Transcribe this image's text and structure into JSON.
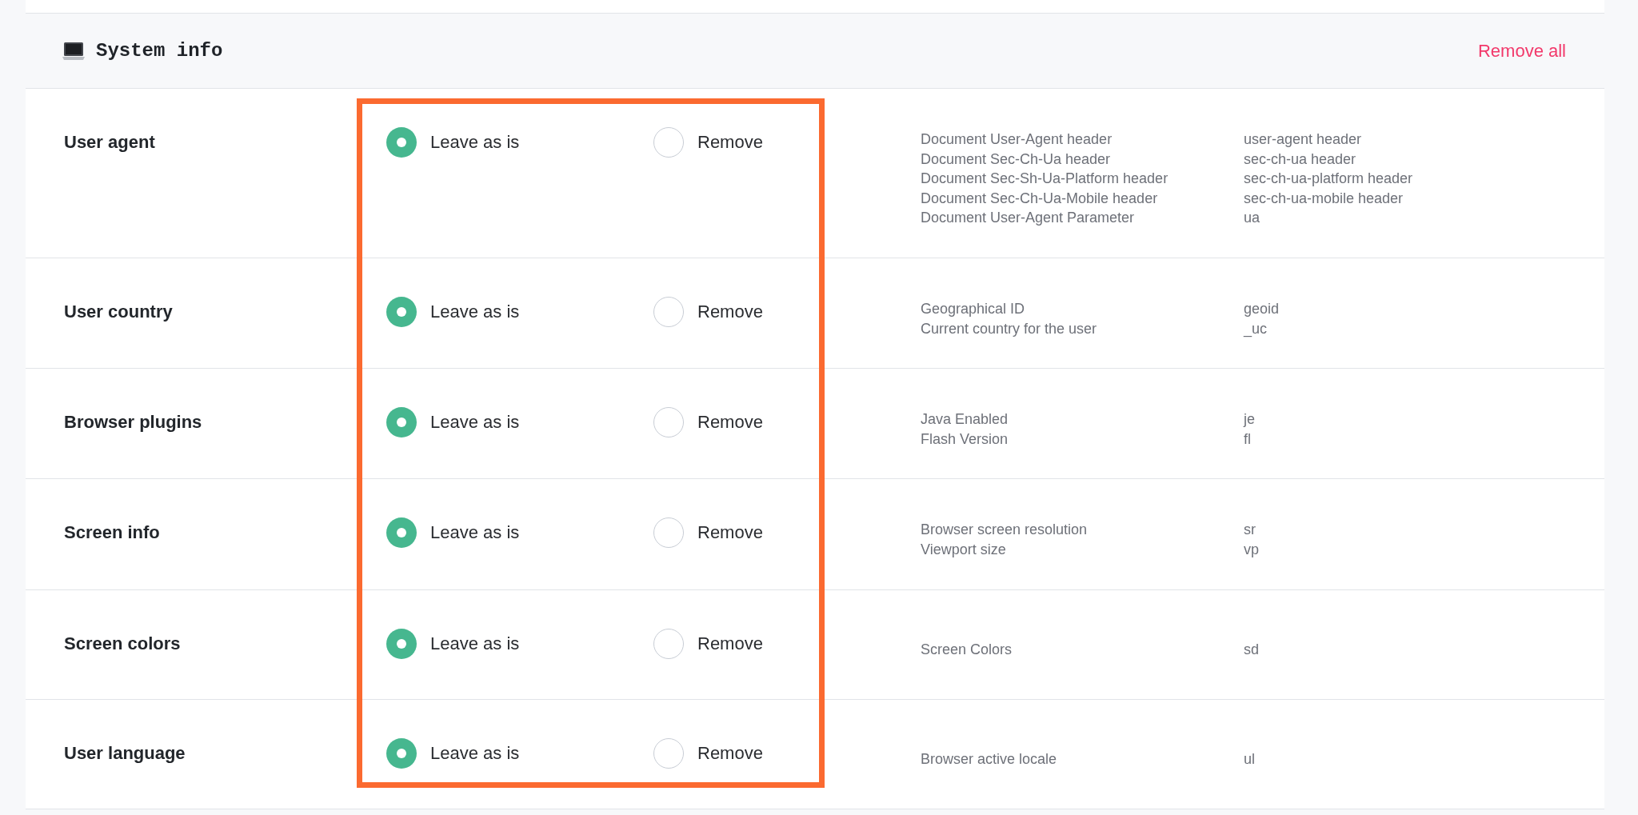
{
  "section": {
    "title": "System info",
    "action": "Remove all"
  },
  "rows": [
    {
      "label": "User agent",
      "options": [
        {
          "label": "Leave as is",
          "selected": true
        },
        {
          "label": "Remove",
          "selected": false
        }
      ],
      "parameters": [
        {
          "name": "Document User-Agent header",
          "key": "user-agent header"
        },
        {
          "name": "Document Sec-Ch-Ua header",
          "key": "sec-ch-ua header"
        },
        {
          "name": "Document Sec-Sh-Ua-Platform header",
          "key": "sec-ch-ua-platform header"
        },
        {
          "name": "Document Sec-Ch-Ua-Mobile header",
          "key": "sec-ch-ua-mobile header"
        },
        {
          "name": "Document User-Agent Parameter",
          "key": "ua"
        }
      ]
    },
    {
      "label": "User country",
      "options": [
        {
          "label": "Leave as is",
          "selected": true
        },
        {
          "label": "Remove",
          "selected": false
        }
      ],
      "parameters": [
        {
          "name": "Geographical ID",
          "key": "geoid"
        },
        {
          "name": "Current country for the user",
          "key": "_uc"
        }
      ]
    },
    {
      "label": "Browser plugins",
      "options": [
        {
          "label": "Leave as is",
          "selected": true
        },
        {
          "label": "Remove",
          "selected": false
        }
      ],
      "parameters": [
        {
          "name": "Java Enabled",
          "key": "je"
        },
        {
          "name": "Flash Version",
          "key": "fl"
        }
      ]
    },
    {
      "label": "Screen info",
      "options": [
        {
          "label": "Leave as is",
          "selected": true
        },
        {
          "label": "Remove",
          "selected": false
        }
      ],
      "parameters": [
        {
          "name": "Browser screen resolution",
          "key": "sr"
        },
        {
          "name": "Viewport size",
          "key": "vp"
        }
      ]
    },
    {
      "label": "Screen colors",
      "options": [
        {
          "label": "Leave as is",
          "selected": true
        },
        {
          "label": "Remove",
          "selected": false
        }
      ],
      "parameters": [
        {
          "name": "Screen Colors",
          "key": "sd"
        }
      ]
    },
    {
      "label": "User language",
      "options": [
        {
          "label": "Leave as is",
          "selected": true
        },
        {
          "label": "Remove",
          "selected": false
        }
      ],
      "parameters": [
        {
          "name": "Browser active locale",
          "key": "ul"
        }
      ]
    }
  ]
}
